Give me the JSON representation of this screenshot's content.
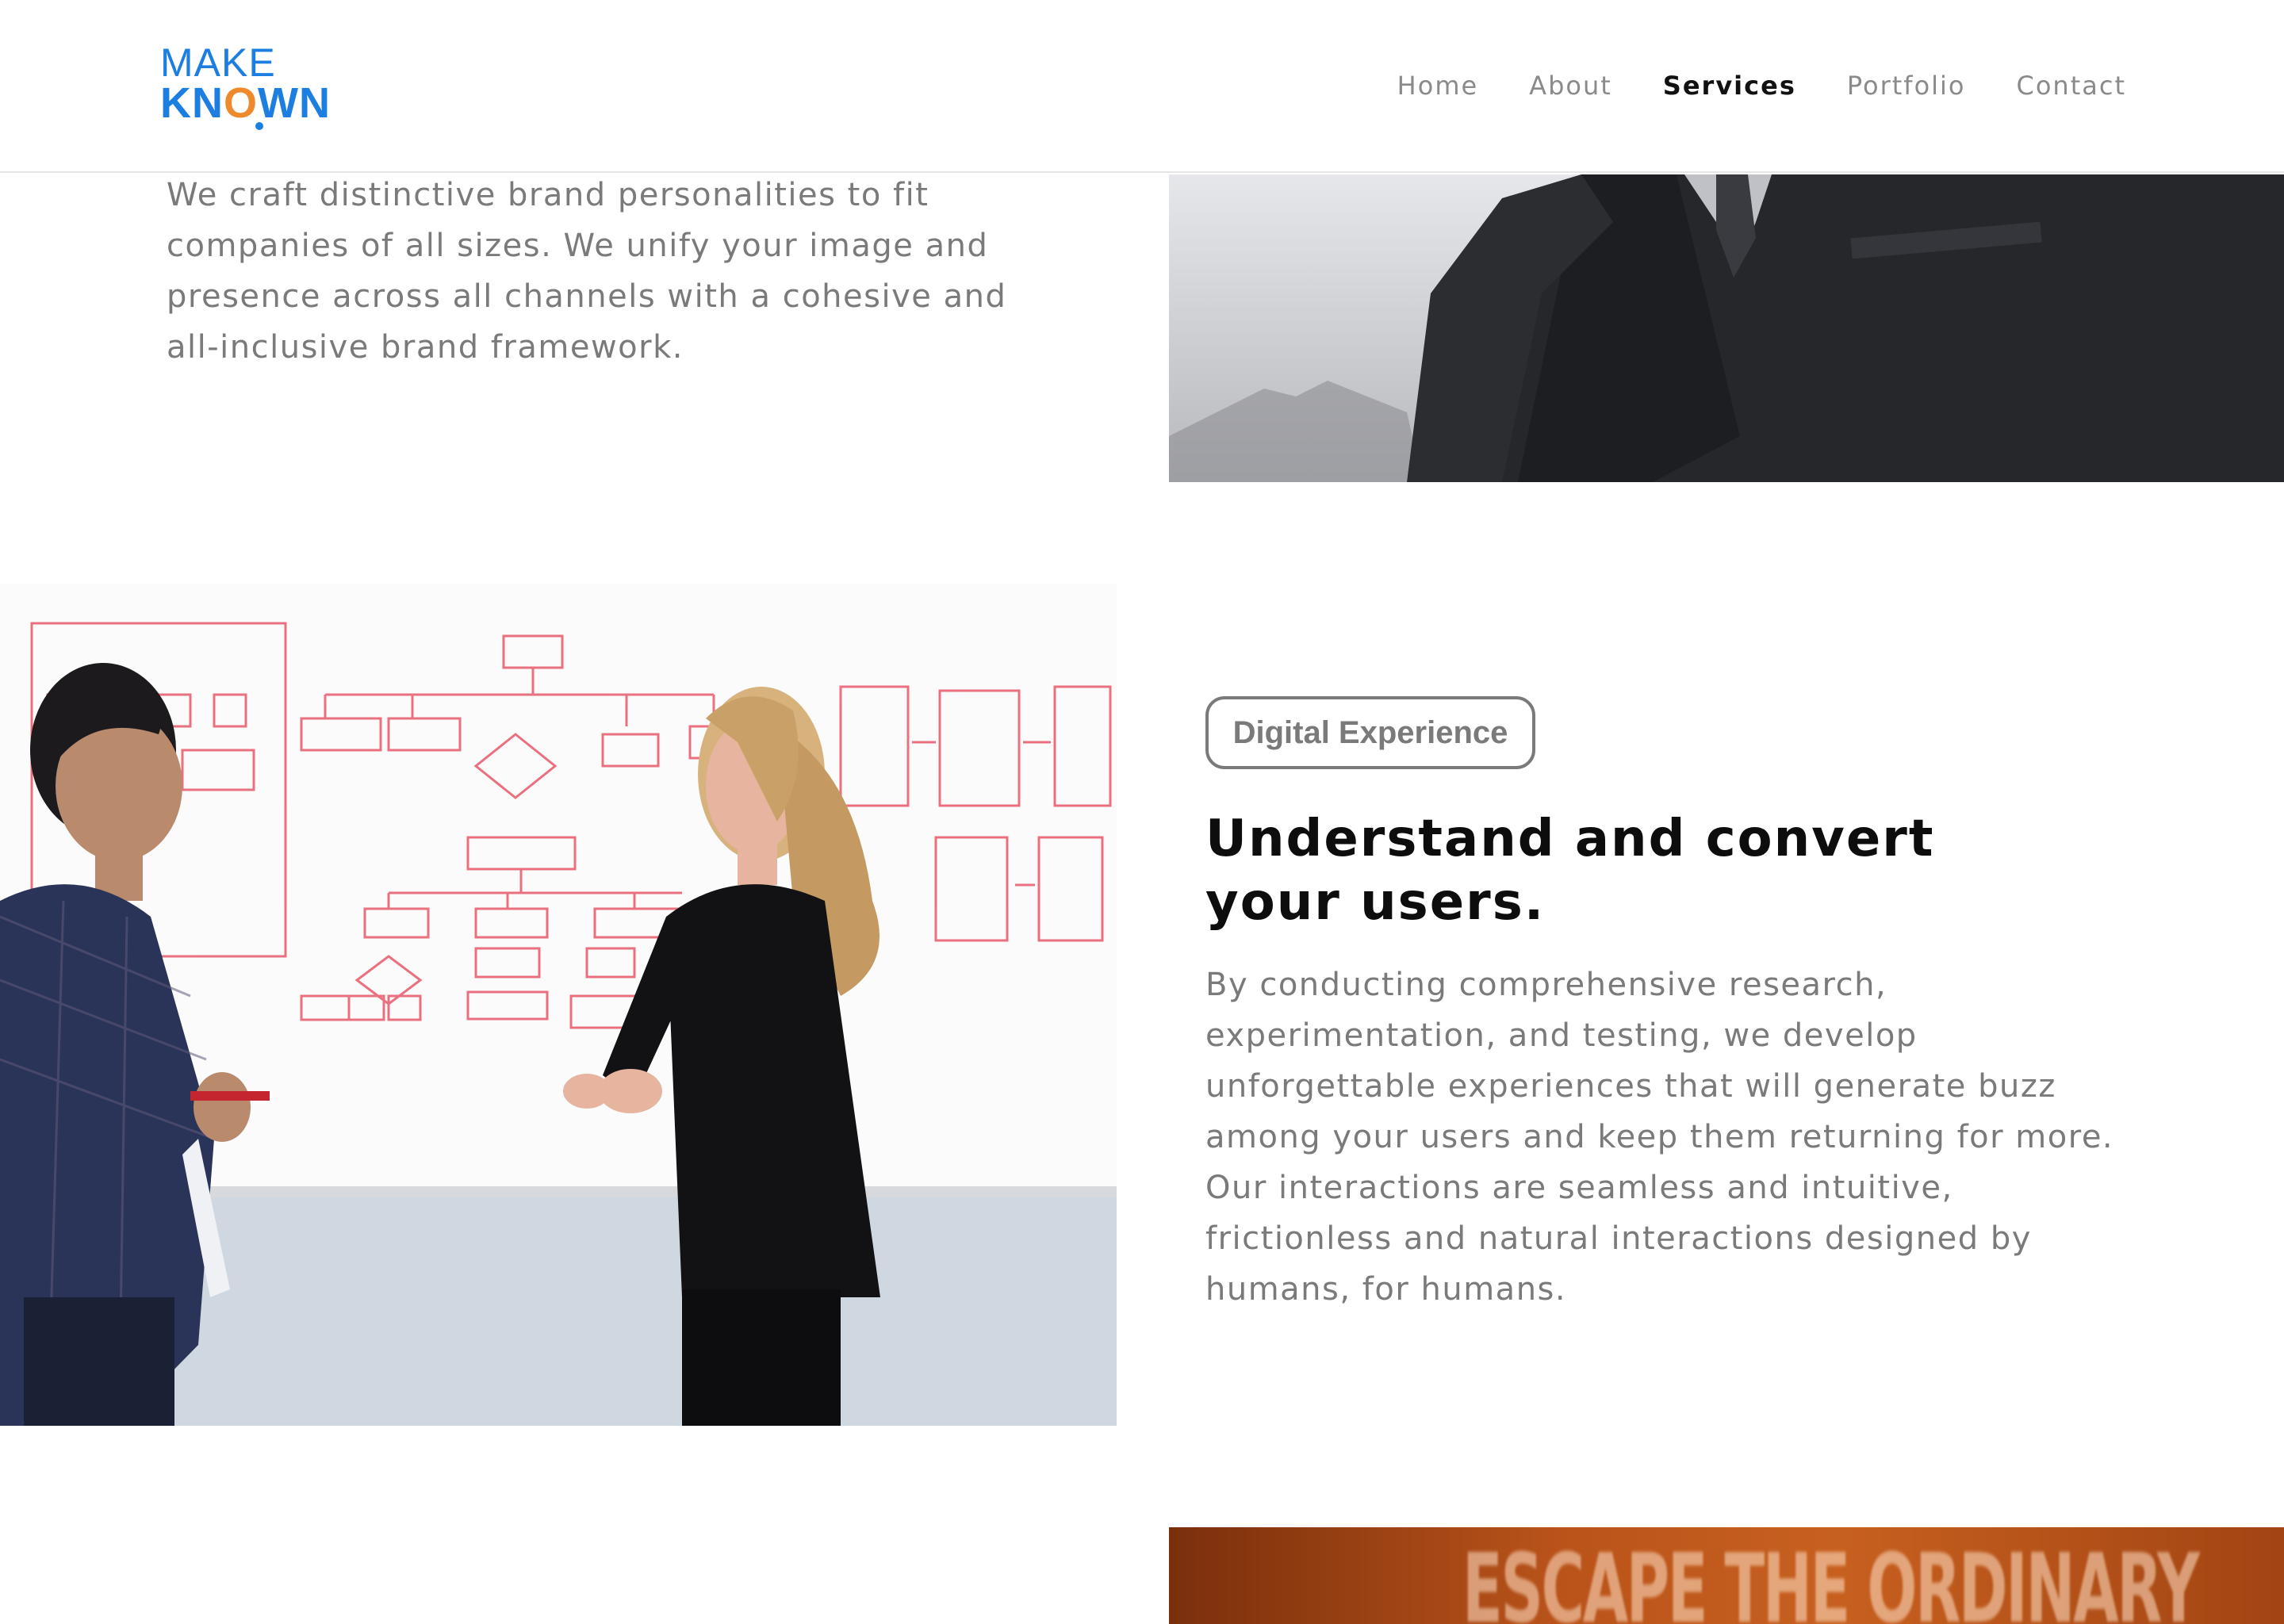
{
  "brand": {
    "line1": "MAKE",
    "line2_a": "KN",
    "line2_o": "O",
    "line2_b": "WN"
  },
  "nav": {
    "items": [
      {
        "label": "Home"
      },
      {
        "label": "About"
      },
      {
        "label": "Services"
      },
      {
        "label": "Portfolio"
      },
      {
        "label": "Contact"
      }
    ],
    "active": "Services"
  },
  "brand_section": {
    "text": "We craft distinctive brand personalities to fit companies of all sizes. We unify your image and presence across all channels with a cohesive and all-inclusive brand framework."
  },
  "digital_section": {
    "badge": "Digital Experience",
    "heading_line1": "Understand and convert",
    "heading_line2": "your users.",
    "text": "By conducting comprehensive research, experimentation, and testing, we develop unforgettable experiences that will generate buzz among your users and keep them returning for more. Our interactions are seamless and intuitive, frictionless and natural interactions designed by humans, for humans."
  },
  "banner": {
    "text": "ESCAPE THE ORDINARY"
  },
  "colors": {
    "brand_blue": "#1b7ee0",
    "brand_orange": "#ef8a2c",
    "body_gray": "#7a7a7a",
    "heading": "#0d0d0d"
  }
}
